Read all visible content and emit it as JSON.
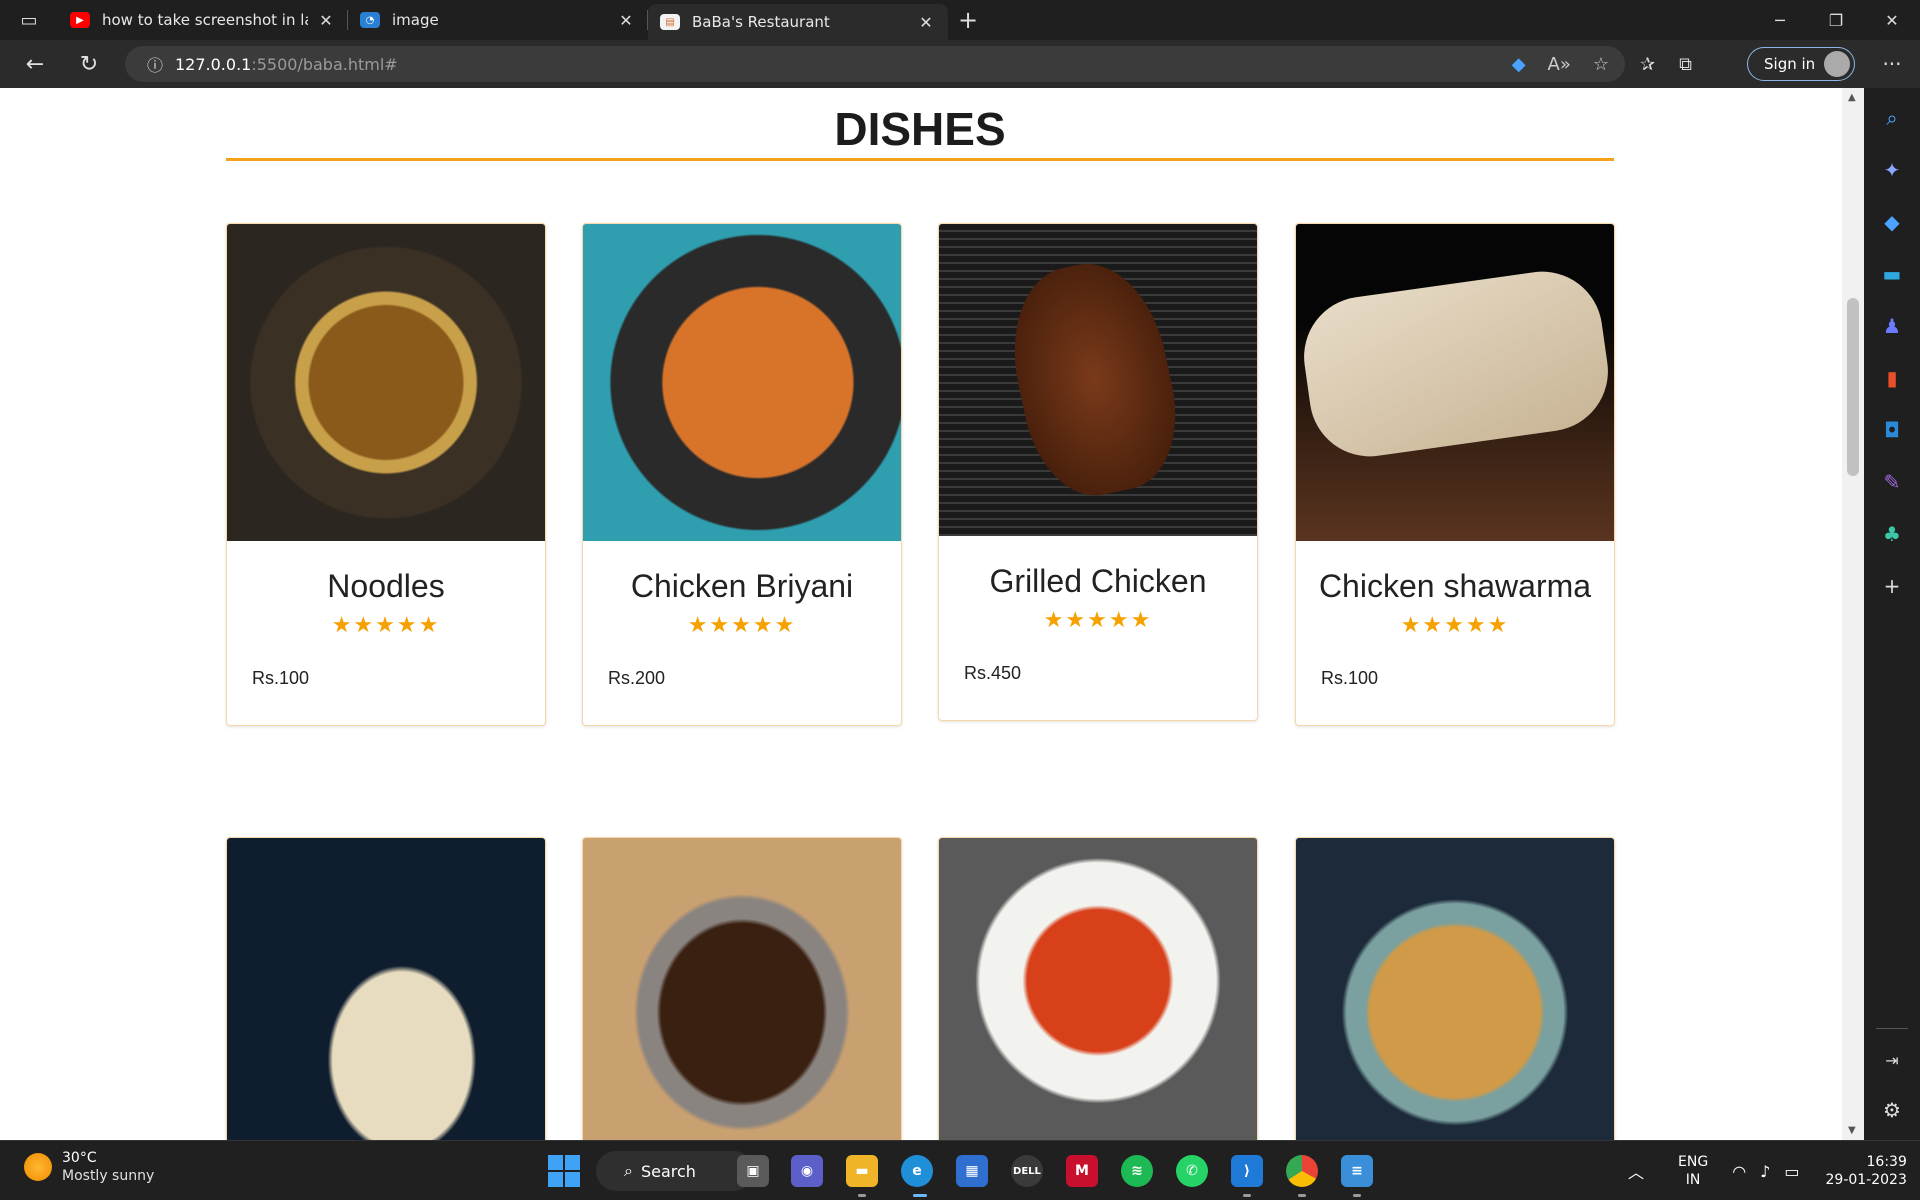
{
  "browser": {
    "tabs": [
      {
        "title": "how to take screenshot in laptop",
        "icon": "youtube-icon",
        "active": false
      },
      {
        "title": "image",
        "icon": "image-site-icon",
        "active": false
      },
      {
        "title": "BaBa's Restaurant",
        "icon": "restaurant-favicon-icon",
        "active": true
      }
    ],
    "url_host": "127.0.0.1",
    "url_rest": ":5500/baba.html#",
    "sign_in_label": "Sign in"
  },
  "page": {
    "heading": "DISHES",
    "accent_color": "#f4a21c",
    "star_color": "#f5a100",
    "dishes": [
      {
        "name": "Noodles",
        "rating": 5,
        "stars": "★★★★★",
        "price": "Rs.100"
      },
      {
        "name": "Chicken Briyani",
        "rating": 5,
        "stars": "★★★★★",
        "price": "Rs.200"
      },
      {
        "name": "Grilled Chicken",
        "rating": 5,
        "stars": "★★★★★",
        "price": "Rs.450"
      },
      {
        "name": "Chicken shawarma",
        "rating": 5,
        "stars": "★★★★★",
        "price": "Rs.100"
      }
    ],
    "dishes_row2_images": [
      "naan",
      "mutton-curry",
      "tomato-soup",
      "samosa"
    ]
  },
  "taskbar": {
    "weather_temp": "30°C",
    "weather_condition": "Mostly sunny",
    "search_label": "Search",
    "lang_top": "ENG",
    "lang_bottom": "IN",
    "time": "16:39",
    "date": "29-01-2023"
  }
}
